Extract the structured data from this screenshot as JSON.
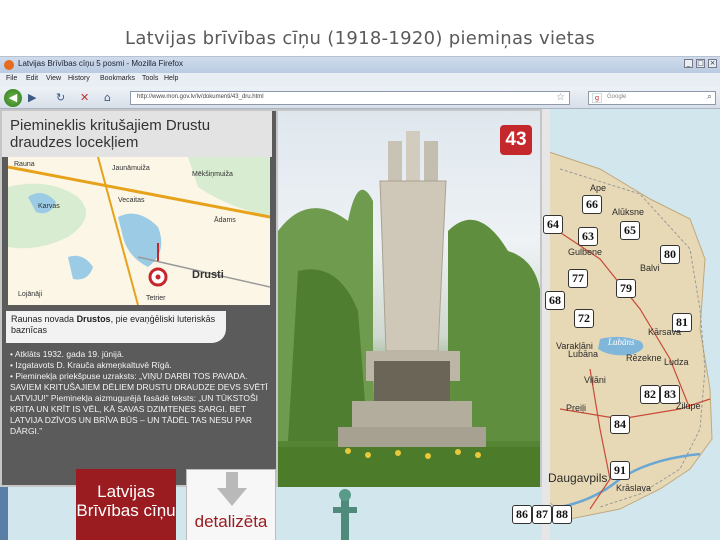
{
  "slide": {
    "title": "Latvijas brīvības cīņu (1918-1920) piemiņas vietas"
  },
  "browser": {
    "window_title": "Latvijas Brīvības cīņu 5 posmi - Mozilla Firefox",
    "menu": [
      "File",
      "Edit",
      "View",
      "History",
      "Bookmarks",
      "Tools",
      "Help"
    ],
    "url": "http://www.mon.gov.lv/lv/dokumenti/43_dru.html",
    "search_placeholder": "Google",
    "window_controls": [
      "_",
      "□",
      "×"
    ]
  },
  "panel": {
    "heading": "Piemineklis kritušajiem Drustu draudzes locekļiem",
    "map_labels": [
      "Jaunāmuiža",
      "Mēkšiņmuiža",
      "Drusti",
      "Karvas",
      "Vecaitas",
      "Rauna",
      "Lojānāji",
      "Ādams",
      "Tetrier"
    ],
    "map_place_bold": "Drusti",
    "caption_prefix": "Raunas novada ",
    "caption_bold": "Drustos",
    "caption_suffix": ", pie evaņģēliski luteriskās baznīcas",
    "facts": [
      "• Atklāts 1932. gada 19. jūnijā.",
      "• Izgatavots D. Krauča akmeņkaltuvē Rīgā.",
      "• Pieminekļa priekšpuse uzraksts: „VIŅU DARBI TOS PAVADA. SAVIEM KRITUŠAJIEM DĒLIEM DRUSTU DRAUDZE DEVS SVĒTĪ LATVIJU!” Pieminekļa aizmugurējā fasādē teksts: „UN TŪKSTOŠI KRITA UN KRĪT IS VĒL, KĀ SAVAS DZIMTENES SARGI. BET LATVIJA DZĪVOS UN BRĪVA BŪS – UN TĀDĒL TAS NESU PAR DĀRGI.”"
    ]
  },
  "photo": {
    "badge": "43"
  },
  "buttons": {
    "latvijas_line1": "Latvijas",
    "latvijas_line2": "Brīvības cīņu",
    "detalizeta": "detalizēta"
  },
  "map": {
    "markers": [
      "66",
      "64",
      "65",
      "63",
      "80",
      "77",
      "79",
      "68",
      "72",
      "81",
      "82",
      "83",
      "84",
      "91",
      "86",
      "87",
      "88"
    ],
    "places": [
      "Ape",
      "Alūksne",
      "Gulbene",
      "Balvi",
      "Lubāna",
      "Kārsava",
      "Rēzekne",
      "Ludza",
      "Viļāni",
      "Zilupe",
      "Preiļi",
      "Daugavpils",
      "Krāslava",
      "Varakļāni"
    ],
    "lake": "Lubāns"
  },
  "colors": {
    "accent_red": "#9a1b20",
    "badge_red": "#c5282c",
    "panel_gray": "#5b5b5b"
  }
}
